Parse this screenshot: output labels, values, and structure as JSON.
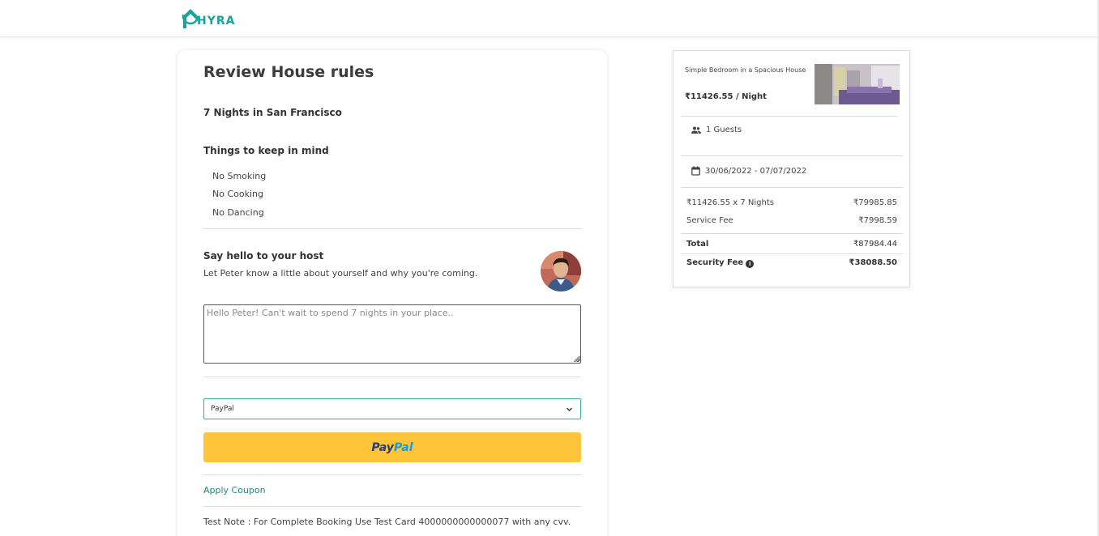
{
  "brand": {
    "name": "HYRA",
    "color": "#1aa39a",
    "logo_icon": "house-roof-icon"
  },
  "review": {
    "title": "Review House rules",
    "trip_summary": "7 Nights in San Francisco",
    "rules_heading": "Things to keep in mind",
    "rules": [
      "No Smoking",
      "No Cooking",
      "No Dancing"
    ],
    "host_heading": "Say hello to your host",
    "host_description": "Let Peter know a little about yourself and why you're coming.",
    "host_avatar": "host-avatar-photo",
    "message_placeholder": "Hello Peter! Can't wait to spend 7 nights in your place..",
    "payment_method": "PayPal",
    "paypal_button": {
      "pay": "Pay",
      "pal": "Pal",
      "color": "#ffc439"
    },
    "coupon_label": "Apply Coupon",
    "test_note": "Test Note : For Complete Booking Use Test Card 4000000000000077 with any cvv."
  },
  "summary": {
    "listing_name": "Simple Bedroom in a Spacious House",
    "listing_price": "₹11426.55 / Night",
    "listing_image": "bedroom-photo",
    "guests": "1 Guests",
    "dates": "30/06/2022 - 07/07/2022",
    "fees": [
      {
        "label": "₹11426.55 x 7 Nights",
        "amount": "₹79985.85"
      },
      {
        "label": "Service Fee",
        "amount": "₹7998.59"
      }
    ],
    "total": {
      "label": "Total",
      "amount": "₹87984.44"
    },
    "security_fee": {
      "label": "Security Fee",
      "amount": "₹38088.50",
      "info_icon": "i"
    }
  }
}
